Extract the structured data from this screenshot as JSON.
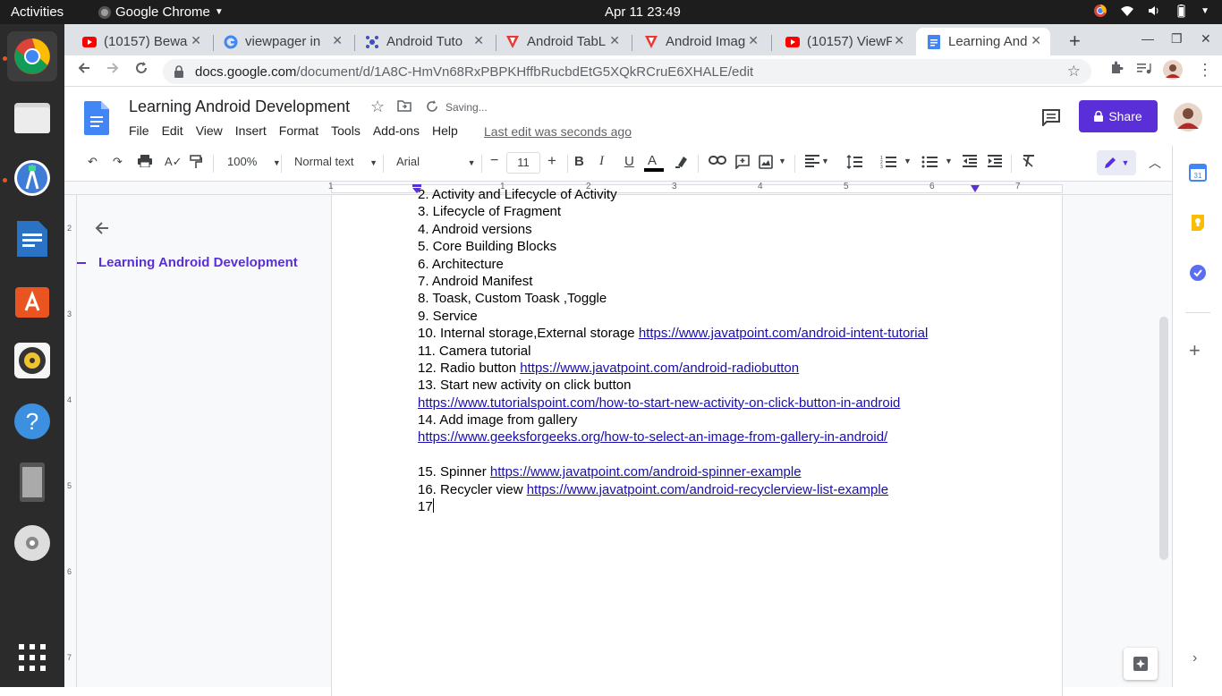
{
  "topbar": {
    "activities": "Activities",
    "app_name": "Google Chrome",
    "clock": "Apr 11  23:49"
  },
  "tabs": [
    {
      "title": "(10157) Bewa",
      "icon": "youtube-icon"
    },
    {
      "title": "viewpager in",
      "icon": "google-icon"
    },
    {
      "title": "Android Tuto",
      "icon": "tutorial-site-icon"
    },
    {
      "title": "Android TabL",
      "icon": "tutorialspoint-icon"
    },
    {
      "title": "Android Imag",
      "icon": "tutorialspoint-icon"
    },
    {
      "title": "(10157) ViewP",
      "icon": "youtube-icon"
    },
    {
      "title": "Learning And",
      "icon": "docs-icon"
    }
  ],
  "address": {
    "domain": "docs.google.com",
    "path": "/document/d/1A8C-HmVn68RxPBPKHffbRucbdEtG5XQkRCruE6XHALE/edit"
  },
  "doc": {
    "title": "Learning Android Development",
    "saving": "Saving...",
    "last_edit": "Last edit was seconds ago",
    "share": "Share",
    "menu": [
      "File",
      "Edit",
      "View",
      "Insert",
      "Format",
      "Tools",
      "Add-ons",
      "Help"
    ]
  },
  "toolbar": {
    "zoom": "100%",
    "style": "Normal text",
    "font": "Arial",
    "font_size": "11"
  },
  "ruler_numbers": [
    "1",
    "1",
    "2",
    "3",
    "4",
    "5",
    "6",
    "7"
  ],
  "vruler_numbers": [
    "2",
    "3",
    "4",
    "5",
    "6",
    "7"
  ],
  "outline": {
    "heading": "Learning Android Development"
  },
  "lines": [
    {
      "text": "2.  Activity and Lifecycle of Activity",
      "link": ""
    },
    {
      "text": "3.  Lifecycle of Fragment",
      "link": ""
    },
    {
      "text": "4.  Android versions",
      "link": ""
    },
    {
      "text": "5.  Core Building Blocks",
      "link": ""
    },
    {
      "text": "6.  Architecture",
      "link": ""
    },
    {
      "text": "7.  Android Manifest",
      "link": ""
    },
    {
      "text": "8.  Toask, Custom Toask ,Toggle",
      "link": ""
    },
    {
      "text": "9.  Service",
      "link": ""
    },
    {
      "text": "10. Internal storage,External storage ",
      "link": "https://www.javatpoint.com/android-intent-tutorial"
    },
    {
      "text": "11. Camera tutorial",
      "link": ""
    },
    {
      "text": "12. Radio button ",
      "link": "https://www.javatpoint.com/android-radiobutton"
    },
    {
      "text": "13. Start new activity on click button",
      "link": ""
    },
    {
      "text": "",
      "link": "https://www.tutorialspoint.com/how-to-start-new-activity-on-click-button-in-android"
    },
    {
      "text": "14. Add image from gallery",
      "link": ""
    },
    {
      "text": "",
      "link": "https://www.geeksforgeeks.org/how-to-select-an-image-from-gallery-in-android/"
    },
    {
      "text": "",
      "link": ""
    },
    {
      "text": "15. Spinner ",
      "link": "https://www.javatpoint.com/android-spinner-example"
    },
    {
      "text": "16. Recycler view ",
      "link": "https://www.javatpoint.com/android-recyclerview-list-example"
    },
    {
      "text": "17",
      "link": ""
    }
  ],
  "colors": {
    "accent": "#5b2fd7",
    "link": "#1a0dab",
    "topbar": "#1d1d1d",
    "dock": "#2b2b2b"
  }
}
